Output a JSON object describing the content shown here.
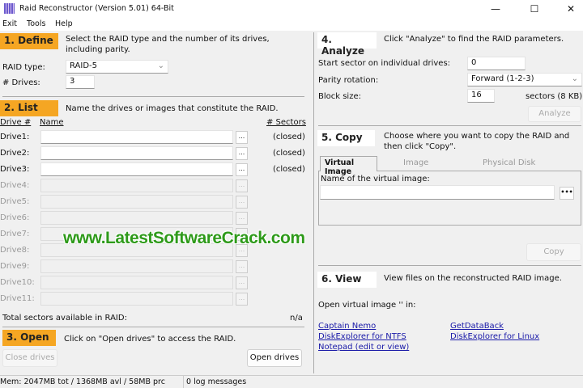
{
  "window": {
    "title": "Raid Reconstructor (Version 5.01) 64-Bit",
    "minimize": "—",
    "maximize": "☐",
    "close": "✕"
  },
  "menu": [
    "Exit",
    "Tools",
    "Help"
  ],
  "define": {
    "step": "1. Define",
    "desc": "Select the RAID type and the number of its drives, including parity.",
    "raid_type_label": "RAID type:",
    "raid_type_value": "RAID-5",
    "drives_label": "# Drives:",
    "drives_value": "3"
  },
  "list": {
    "step": "2. List",
    "desc": "Name the drives or images that constitute the RAID.",
    "col_drive": "Drive #",
    "col_name": "Name",
    "col_sectors": "# Sectors",
    "drives": [
      {
        "label": "Drive1:",
        "status": "(closed)",
        "enabled": true
      },
      {
        "label": "Drive2:",
        "status": "(closed)",
        "enabled": true
      },
      {
        "label": "Drive3:",
        "status": "(closed)",
        "enabled": true
      },
      {
        "label": "Drive4:",
        "status": "",
        "enabled": false
      },
      {
        "label": "Drive5:",
        "status": "",
        "enabled": false
      },
      {
        "label": "Drive6:",
        "status": "",
        "enabled": false
      },
      {
        "label": "Drive7:",
        "status": "",
        "enabled": false
      },
      {
        "label": "Drive8:",
        "status": "",
        "enabled": false
      },
      {
        "label": "Drive9:",
        "status": "",
        "enabled": false
      },
      {
        "label": "Drive10:",
        "status": "",
        "enabled": false
      },
      {
        "label": "Drive11:",
        "status": "",
        "enabled": false
      }
    ],
    "browse": "...",
    "total_label": "Total sectors available in RAID:",
    "total_value": "n/a"
  },
  "open": {
    "step": "3. Open",
    "desc": "Click on \"Open drives\" to access the RAID.",
    "close_btn": "Close drives",
    "open_btn": "Open drives"
  },
  "analyze": {
    "step": "4. Analyze",
    "desc": "Click \"Analyze\" to find the RAID parameters.",
    "start_label": "Start sector on individual drives:",
    "start_value": "0",
    "parity_label": "Parity rotation:",
    "parity_value": "Forward (1-2-3)",
    "block_label": "Block size:",
    "block_value": "16",
    "block_unit": "sectors (8 KB)",
    "button": "Analyze"
  },
  "copy": {
    "step": "5. Copy",
    "desc": "Choose where you want to copy the RAID and then click \"Copy\".",
    "tabs": [
      "Virtual Image",
      "Image",
      "Physical Disk"
    ],
    "name_label": "Name of the virtual image:",
    "name_value": "",
    "browse": "•••",
    "button": "Copy"
  },
  "view": {
    "step": "6. View",
    "desc": "View files on the reconstructed RAID image.",
    "open_label": "Open virtual image '' in:",
    "links": [
      "Captain Nemo",
      "DiskExplorer for NTFS",
      "Notepad (edit or view)",
      "GetDataBack",
      "DiskExplorer for Linux"
    ]
  },
  "status": {
    "mem": "Mem: 2047MB tot / 1368MB avl / 58MB prc",
    "log": "0 log messages"
  },
  "watermark": "www.LatestSoftwareCrack.com"
}
